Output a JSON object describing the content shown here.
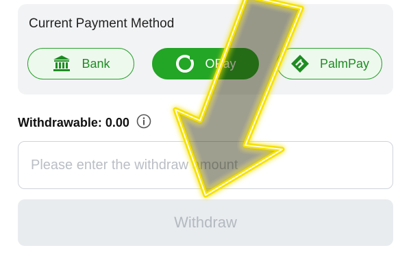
{
  "payment_card": {
    "title": "Current Payment Method",
    "methods": [
      {
        "label": "Bank",
        "icon": "bank-icon",
        "selected": false
      },
      {
        "label": "OPay",
        "icon": "opay-icon",
        "selected": true
      },
      {
        "label": "PalmPay",
        "icon": "palmpay-icon",
        "selected": false
      }
    ]
  },
  "withdrawable": {
    "label": "Withdrawable: 0.00",
    "info_icon": "info-icon"
  },
  "amount_input": {
    "placeholder": "Please enter the withdraw amount",
    "value": ""
  },
  "withdraw_button": {
    "label": "Withdraw",
    "enabled": false
  },
  "overlay": {
    "icon": "arrow-down-left-icon",
    "color": "#f5e100"
  },
  "colors": {
    "brand_green": "#23a526",
    "card_background": "#f2f3f5",
    "disabled_button": "#e9ecef"
  }
}
